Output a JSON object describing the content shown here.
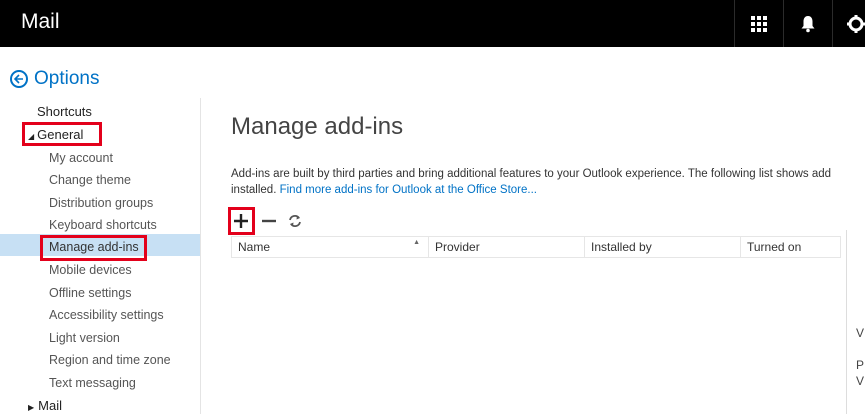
{
  "header": {
    "app_title": "Mail"
  },
  "options": {
    "label": "Options"
  },
  "nav": {
    "shortcuts": "Shortcuts",
    "general": "General",
    "items": [
      "My account",
      "Change theme",
      "Distribution groups",
      "Keyboard shortcuts",
      "Manage add-ins",
      "Mobile devices",
      "Offline settings",
      "Accessibility settings",
      "Light version",
      "Region and time zone",
      "Text messaging"
    ],
    "mail": "Mail"
  },
  "main": {
    "title": "Manage add-ins",
    "description_line1": "Add-ins are built by third parties and bring additional features to your Outlook experience. The following list shows add",
    "description_line2_prefix": "installed. ",
    "store_link": "Find more add-ins for Outlook at the Office Store...",
    "columns": [
      "Name",
      "Provider",
      "Installed by",
      "Turned on"
    ]
  },
  "right_panel": {
    "char1": "V",
    "char2": "P",
    "char3": "V"
  }
}
